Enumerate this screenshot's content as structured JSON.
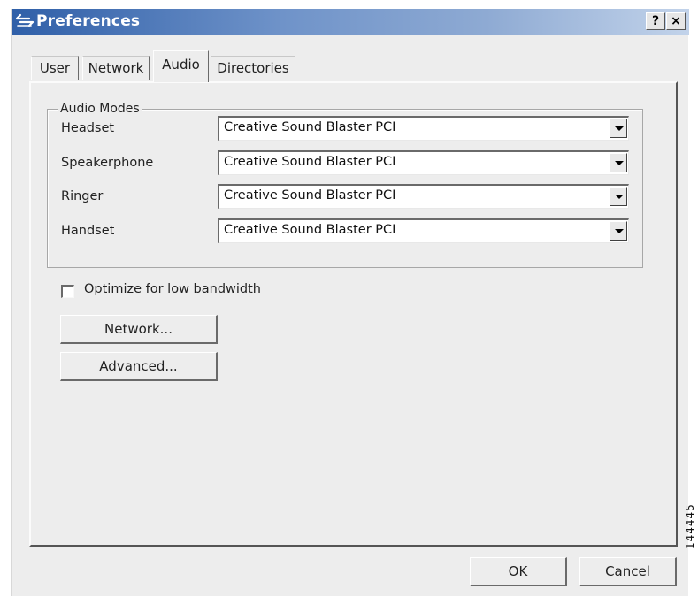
{
  "window": {
    "title": "Preferences",
    "help_button": "?",
    "close_button": "×"
  },
  "tabs": [
    {
      "label": "User",
      "active": false
    },
    {
      "label": "Network",
      "active": false
    },
    {
      "label": "Audio",
      "active": true
    },
    {
      "label": "Directories",
      "active": false
    }
  ],
  "audio_modes": {
    "group_label": "Audio Modes",
    "rows": [
      {
        "label": "Headset",
        "value": "Creative Sound Blaster PCI"
      },
      {
        "label": "Speakerphone",
        "value": "Creative Sound Blaster PCI"
      },
      {
        "label": "Ringer",
        "value": "Creative Sound Blaster PCI"
      },
      {
        "label": "Handset",
        "value": "Creative Sound Blaster PCI"
      }
    ]
  },
  "optimize": {
    "label": "Optimize for low bandwidth",
    "checked": false
  },
  "buttons": {
    "network": "Network...",
    "advanced": "Advanced...",
    "ok": "OK",
    "cancel": "Cancel"
  },
  "figure_code": "144445",
  "colors": {
    "titlebar_start": "#2f5fa8",
    "titlebar_end": "#c2d3ea",
    "dialog_bg": "#ededed"
  },
  "icons": {
    "app": "arrows-exchange-icon",
    "dropdown": "chevron-down-icon"
  }
}
